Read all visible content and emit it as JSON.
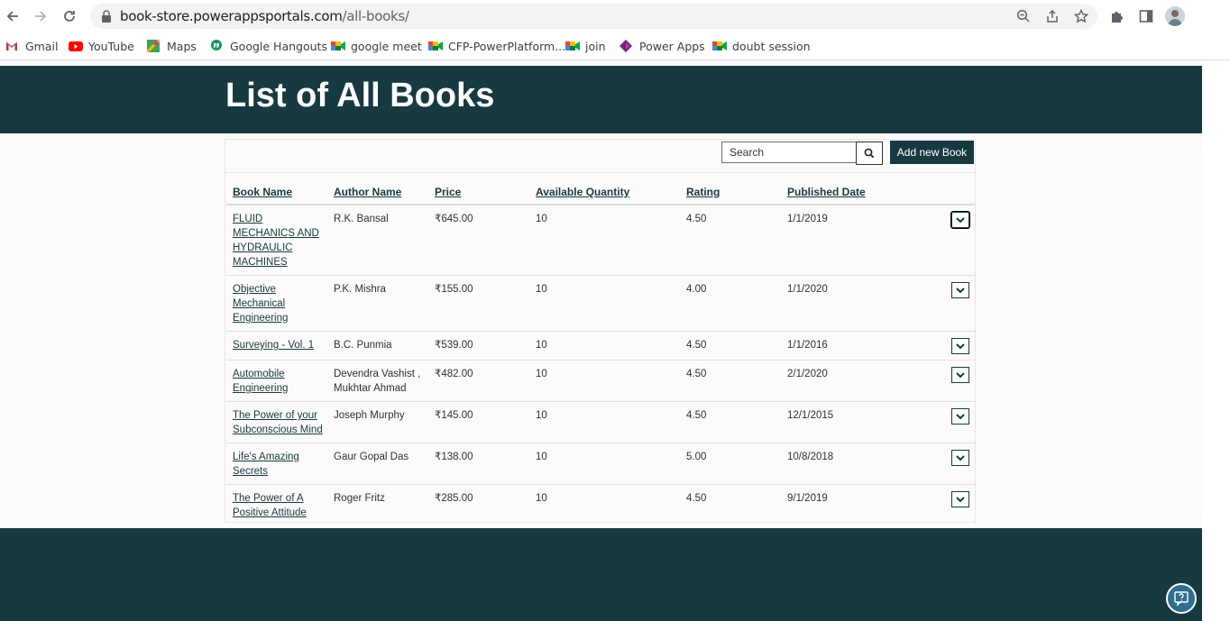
{
  "browser": {
    "url_host": "book-store.powerappsportals.com",
    "url_path": "/all-books/",
    "bookmarks": [
      {
        "label": "Gmail",
        "icon": "gmail-icon"
      },
      {
        "label": "YouTube",
        "icon": "youtube-icon"
      },
      {
        "label": "Maps",
        "icon": "maps-icon"
      },
      {
        "label": "Google Hangouts",
        "icon": "hangouts-icon"
      },
      {
        "label": "google meet",
        "icon": "meet-icon"
      },
      {
        "label": "CFP-PowerPlatform...",
        "icon": "meet-icon"
      },
      {
        "label": "join",
        "icon": "meet-icon"
      },
      {
        "label": "Power Apps",
        "icon": "powerapps-icon"
      },
      {
        "label": "doubt session",
        "icon": "meet-icon"
      }
    ]
  },
  "page": {
    "title": "List of All Books",
    "search_placeholder": "Search",
    "add_button": "Add new Book",
    "colors": {
      "brand": "#173a40",
      "background": "#fcfafa"
    }
  },
  "table": {
    "headers": [
      "Book Name",
      "Author Name",
      "Price",
      "Available Quantity",
      "Rating",
      "Published Date"
    ],
    "rows": [
      {
        "name": "FLUID MECHANICS AND HYDRAULIC MACHINES",
        "author": "R.K. Bansal",
        "price": "₹645.00",
        "qty": "10",
        "rating": "4.50",
        "date": "1/1/2019"
      },
      {
        "name": "Objective Mechanical Engineering",
        "author": "P.K. Mishra",
        "price": "₹155.00",
        "qty": "10",
        "rating": "4.00",
        "date": "1/1/2020"
      },
      {
        "name": "Surveying - Vol. 1",
        "author": "B.C. Punmia",
        "price": "₹539.00",
        "qty": "10",
        "rating": "4.50",
        "date": "1/1/2016"
      },
      {
        "name": "Automobile Engineering",
        "author": "Devendra Vashist , Mukhtar Ahmad",
        "price": "₹482.00",
        "qty": "10",
        "rating": "4.50",
        "date": "2/1/2020"
      },
      {
        "name": "The Power of your Subconscious Mind",
        "author": "Joseph Murphy",
        "price": "₹145.00",
        "qty": "10",
        "rating": "4.50",
        "date": "12/1/2015"
      },
      {
        "name": "Life's Amazing Secrets",
        "author": "Gaur Gopal Das",
        "price": "₹138.00",
        "qty": "10",
        "rating": "5.00",
        "date": "10/8/2018"
      },
      {
        "name": "The Power of A Positive Attitude",
        "author": "Roger Fritz",
        "price": "₹285.00",
        "qty": "10",
        "rating": "4.50",
        "date": "9/1/2019"
      }
    ]
  }
}
